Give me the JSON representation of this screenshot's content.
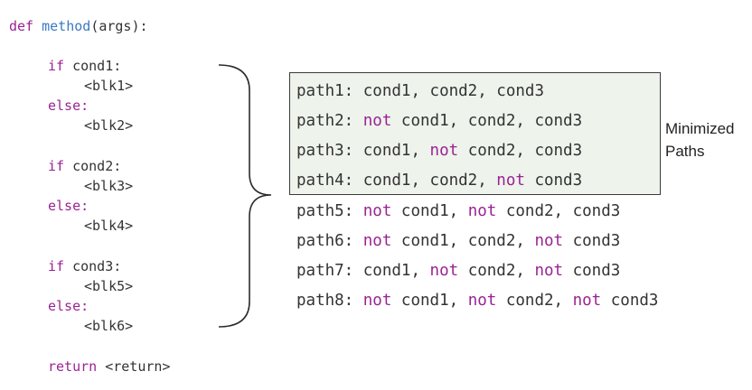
{
  "colors": {
    "keyword": "#9b2393",
    "function": "#3b78c4",
    "text": "#333333",
    "box_fill": "#eef3ec",
    "box_border": "#3a3a3a"
  },
  "code": {
    "def_kw": "def",
    "method_name": "method",
    "signature_rest": "(args):",
    "blocks": [
      {
        "if_kw": "if",
        "cond": "cond1:",
        "then_blk": "<blk1>",
        "else_kw": "else:",
        "else_blk": "<blk2>"
      },
      {
        "if_kw": "if",
        "cond": "cond2:",
        "then_blk": "<blk3>",
        "else_kw": "else:",
        "else_blk": "<blk4>"
      },
      {
        "if_kw": "if",
        "cond": "cond3:",
        "then_blk": "<blk5>",
        "else_kw": "else:",
        "else_blk": "<blk6>"
      }
    ],
    "return_kw": "return",
    "return_value": "<return>"
  },
  "minimized_label": {
    "line1": "Minimized",
    "line2": "Paths"
  },
  "paths": [
    {
      "label": "path1:",
      "parts": [
        {
          "not": "",
          "cond": "cond1,"
        },
        {
          "not": "",
          "cond": "cond2,"
        },
        {
          "not": "",
          "cond": "cond3"
        }
      ]
    },
    {
      "label": "path2:",
      "parts": [
        {
          "not": "not",
          "cond": "cond1,"
        },
        {
          "not": "",
          "cond": "cond2,"
        },
        {
          "not": "",
          "cond": "cond3"
        }
      ]
    },
    {
      "label": "path3:",
      "parts": [
        {
          "not": "",
          "cond": "cond1,"
        },
        {
          "not": "not",
          "cond": "cond2,"
        },
        {
          "not": "",
          "cond": "cond3"
        }
      ]
    },
    {
      "label": "path4:",
      "parts": [
        {
          "not": "",
          "cond": "cond1,"
        },
        {
          "not": "",
          "cond": "cond2,"
        },
        {
          "not": "not",
          "cond": "cond3"
        }
      ]
    },
    {
      "label": "path5:",
      "parts": [
        {
          "not": "not",
          "cond": "cond1,"
        },
        {
          "not": "not",
          "cond": "cond2,"
        },
        {
          "not": "",
          "cond": "cond3"
        }
      ]
    },
    {
      "label": "path6:",
      "parts": [
        {
          "not": "not",
          "cond": "cond1,"
        },
        {
          "not": "",
          "cond": "cond2,"
        },
        {
          "not": "not",
          "cond": "cond3"
        }
      ]
    },
    {
      "label": "path7:",
      "parts": [
        {
          "not": "",
          "cond": "cond1,"
        },
        {
          "not": "not",
          "cond": "cond2,"
        },
        {
          "not": "not",
          "cond": "cond3"
        }
      ]
    },
    {
      "label": "path8:",
      "parts": [
        {
          "not": "not",
          "cond": "cond1,"
        },
        {
          "not": "not",
          "cond": "cond2,"
        },
        {
          "not": "not",
          "cond": "cond3"
        }
      ]
    }
  ]
}
